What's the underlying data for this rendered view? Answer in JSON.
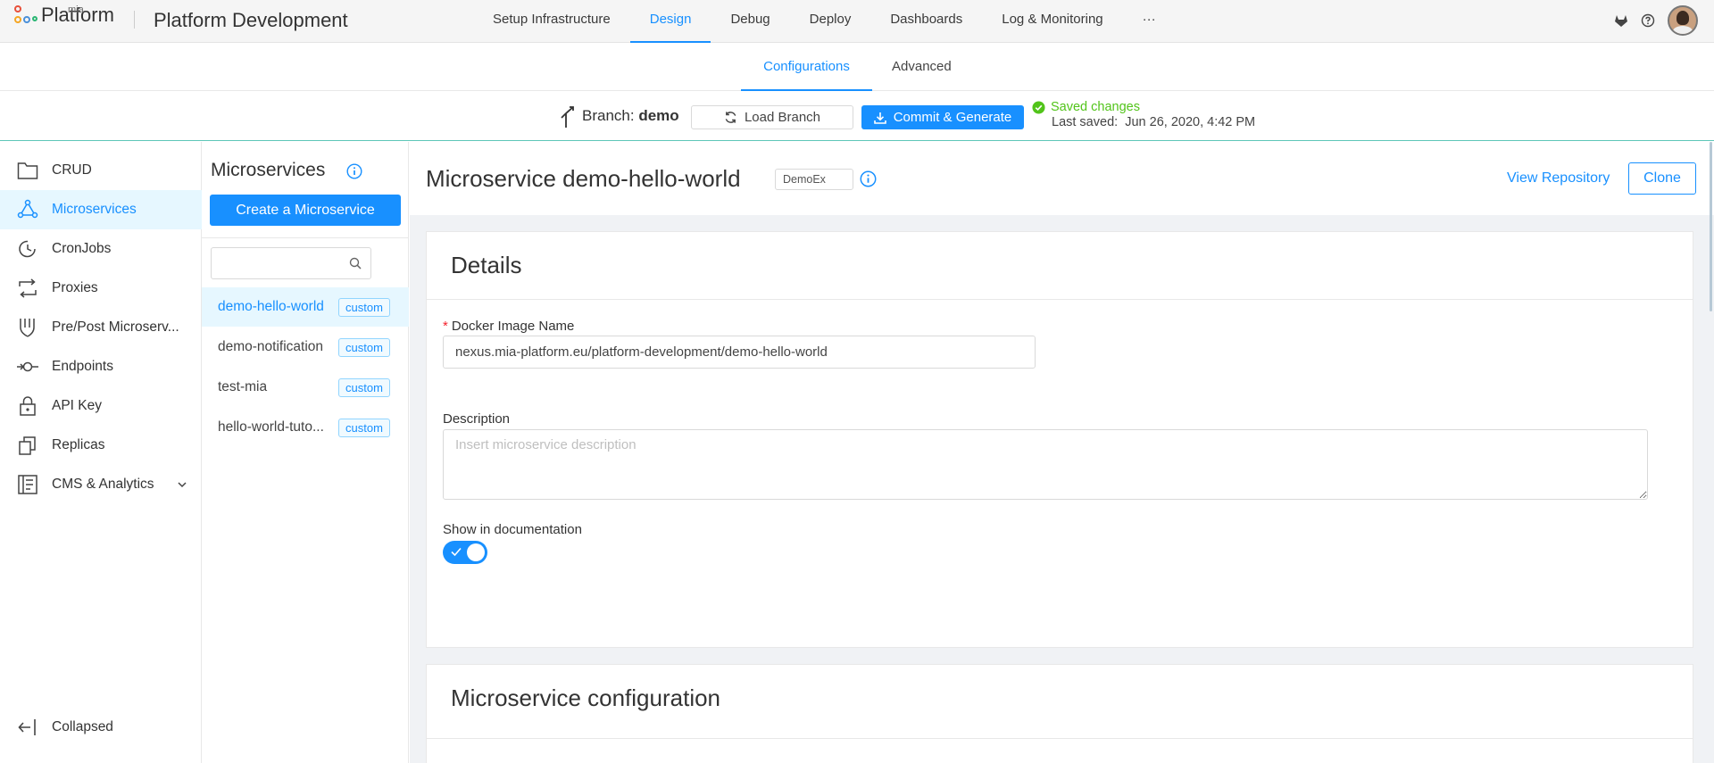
{
  "header": {
    "logo_small": "mia",
    "logo_text": "Platform",
    "project_title": "Platform Development",
    "nav": [
      {
        "label": "Setup Infrastructure"
      },
      {
        "label": "Design"
      },
      {
        "label": "Debug"
      },
      {
        "label": "Deploy"
      },
      {
        "label": "Dashboards"
      },
      {
        "label": "Log & Monitoring"
      },
      {
        "label": "···"
      }
    ],
    "active_nav": "Design"
  },
  "subtabs": {
    "configurations": "Configurations",
    "advanced": "Advanced",
    "active": "Configurations"
  },
  "branchbar": {
    "branch_prefix": "Branch:",
    "branch_name": "demo",
    "load_branch": "Load Branch",
    "commit_generate": "Commit & Generate",
    "saved_changes": "Saved changes",
    "last_saved_label": "Last saved:",
    "last_saved_value": "Jun 26, 2020, 4:42 PM"
  },
  "sidebar": {
    "items": [
      {
        "label": "CRUD",
        "icon": "folder-icon"
      },
      {
        "label": "Microservices",
        "icon": "microservices-icon"
      },
      {
        "label": "CronJobs",
        "icon": "clock-icon"
      },
      {
        "label": "Proxies",
        "icon": "swap-icon"
      },
      {
        "label": "Pre/Post Microserv...",
        "icon": "fork-icon"
      },
      {
        "label": "Endpoints",
        "icon": "endpoint-icon"
      },
      {
        "label": "API Key",
        "icon": "lock-icon"
      },
      {
        "label": "Replicas",
        "icon": "copy-icon"
      },
      {
        "label": "CMS & Analytics",
        "icon": "form-icon"
      }
    ],
    "active": "Microservices",
    "collapse_label": "Collapsed"
  },
  "microservices": {
    "title": "Microservices",
    "create_button": "Create a Microservice",
    "search_placeholder": "",
    "items": [
      {
        "name": "demo-hello-world",
        "tag": "custom"
      },
      {
        "name": "demo-notification",
        "tag": "custom"
      },
      {
        "name": "test-mia",
        "tag": "custom"
      },
      {
        "name": "hello-world-tuto...",
        "tag": "custom"
      }
    ],
    "selected": "demo-hello-world"
  },
  "main": {
    "title": "Microservice demo-hello-world",
    "env_tag": "DemoEx",
    "view_repository": "View Repository",
    "clone": "Clone",
    "details_card": {
      "title": "Details",
      "docker_label": "Docker Image Name",
      "docker_value": "nexus.mia-platform.eu/platform-development/demo-hello-world",
      "description_label": "Description",
      "description_placeholder": "Insert microservice description",
      "show_docs_label": "Show in documentation",
      "show_docs_enabled": true
    },
    "config_card": {
      "title": "Microservice configuration"
    }
  },
  "colors": {
    "accent": "#1890ff",
    "success": "#52c41a",
    "active_bg": "#e6f7ff",
    "branch_border": "#5ec7b8"
  }
}
